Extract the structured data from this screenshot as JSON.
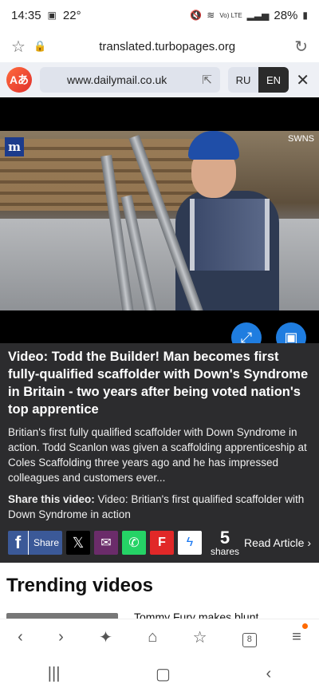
{
  "status_bar": {
    "time": "14:35",
    "temperature": "22°",
    "battery": "28%",
    "network": "Vo) LTE"
  },
  "url_bar": {
    "url": "translated.turbopages.org"
  },
  "translate_bar": {
    "source_url": "www.dailymail.co.uk",
    "lang_from": "RU",
    "lang_to": "EN",
    "active_lang": "EN"
  },
  "video": {
    "credit": "SWNS",
    "publisher_mark": "m"
  },
  "article": {
    "headline": "Video: Todd the Builder! Man becomes first fully-qualified scaffolder with Down's Syndrome in Britain - two years after being voted nation's top apprentice",
    "summary": "Britian's first fully qualified scaffolder with Down Syndrome in action. Todd Scanlon was given a scaffolding apprenticeship at Coles Scaffolding three years ago and he has impressed colleagues and customers ever...",
    "share_label": "Share this video:",
    "share_text": " Video: Britian's first qualified scaffolder with Down Syndrome in action"
  },
  "share_row": {
    "facebook_label": "Share",
    "shares_count": "5",
    "shares_label": "shares",
    "read_article": "Read Article"
  },
  "trending": {
    "title": "Trending videos",
    "first_item_text": "Tommy Fury makes blunt"
  },
  "bottom_nav": {
    "tabs_count": "8"
  },
  "colors": {
    "accent_blue": "#1f7de0",
    "facebook": "#3b5998",
    "article_bg": "#2c2c2e",
    "translate_bar_bg": "#eef0f5"
  }
}
